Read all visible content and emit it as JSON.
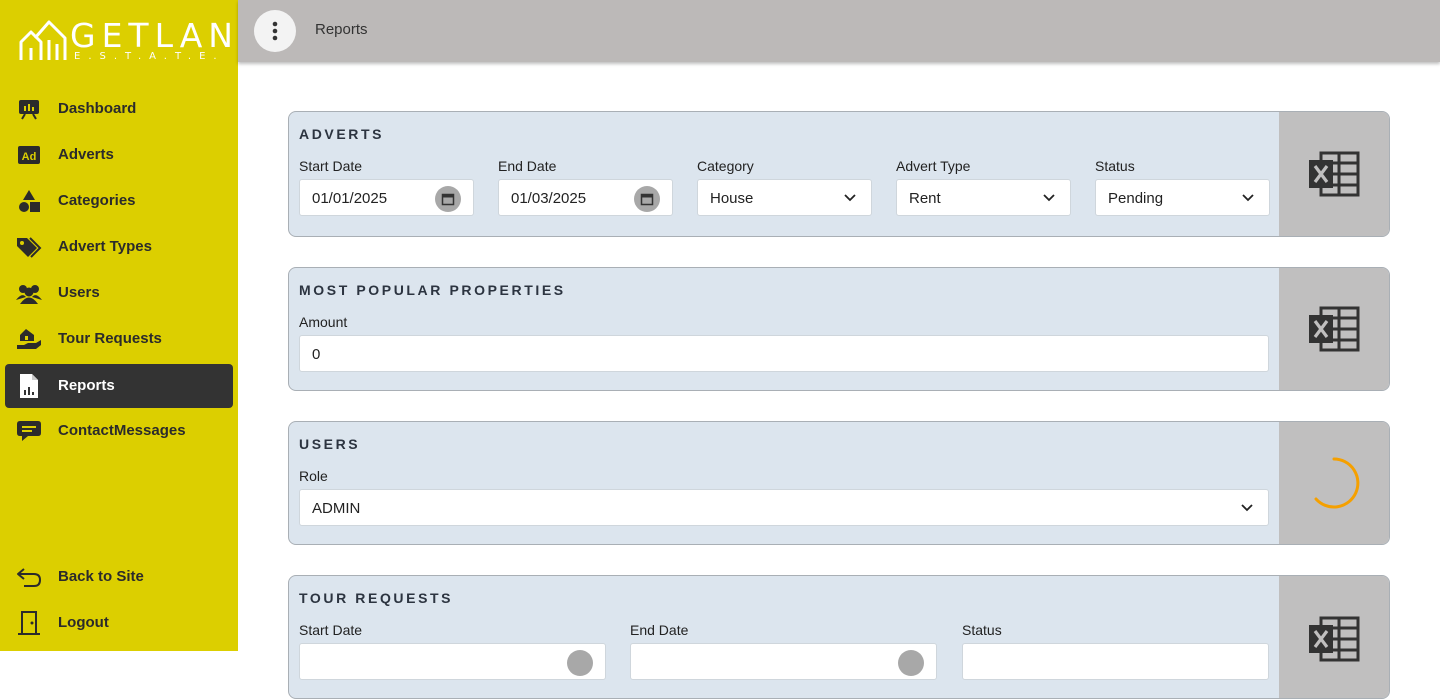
{
  "logo": {
    "word": "GETLAND",
    "sub": "E.S.T.A.T.E."
  },
  "sidebar": {
    "items": [
      {
        "label": "Dashboard",
        "icon": "dashboard-icon"
      },
      {
        "label": "Adverts",
        "icon": "ad-icon"
      },
      {
        "label": "Categories",
        "icon": "shapes-icon"
      },
      {
        "label": "Advert Types",
        "icon": "tags-icon"
      },
      {
        "label": "Users",
        "icon": "users-icon"
      },
      {
        "label": "Tour Requests",
        "icon": "tour-request-icon"
      },
      {
        "label": "Reports",
        "icon": "report-file-icon",
        "active": true
      },
      {
        "label": "ContactMessages",
        "icon": "chat-icon"
      }
    ],
    "bottom": [
      {
        "label": "Back to Site",
        "icon": "back-arrow-icon"
      },
      {
        "label": "Logout",
        "icon": "door-icon"
      }
    ]
  },
  "topbar": {
    "breadcrumb": "Reports",
    "menu_icon": "vertical-dots-icon"
  },
  "adverts": {
    "title": "ADVERTS",
    "start_label": "Start Date",
    "start_value": "01/01/2025",
    "end_label": "End Date",
    "end_value": "01/03/2025",
    "category_label": "Category",
    "category_value": "House",
    "type_label": "Advert Type",
    "type_value": "Rent",
    "status_label": "Status",
    "status_value": "Pending"
  },
  "popular": {
    "title": "MOST POPULAR PROPERTIES",
    "amount_label": "Amount",
    "amount_value": "0"
  },
  "users": {
    "title": "USERS",
    "role_label": "Role",
    "role_value": "ADMIN"
  },
  "tours": {
    "title": "TOUR REQUESTS",
    "start_label": "Start Date",
    "end_label": "End Date",
    "status_label": "Status"
  },
  "colors": {
    "sidebar": "#dccf00",
    "active": "#333333",
    "card": "#dce5ee",
    "spinner": "#f5a000"
  }
}
